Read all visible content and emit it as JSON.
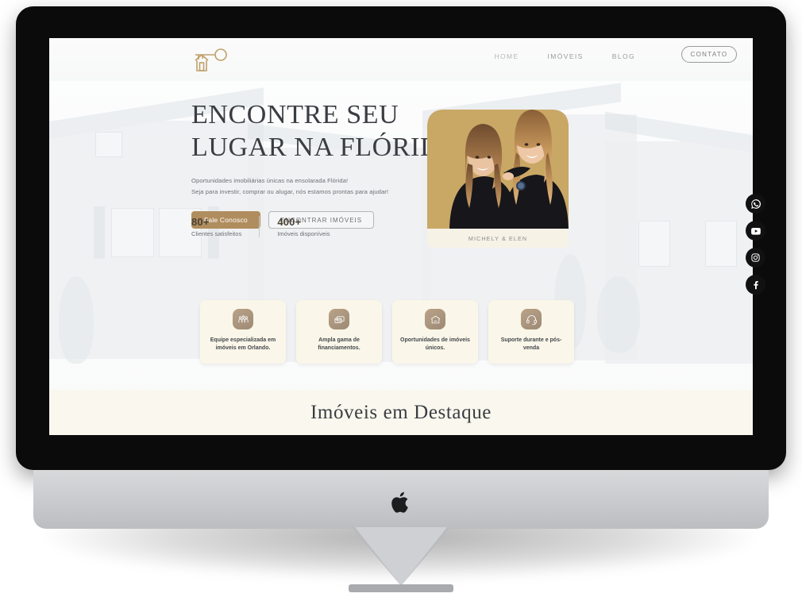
{
  "device": {
    "brand_icon": "apple-logo"
  },
  "site": {
    "logo": "key-house-logo",
    "nav": [
      {
        "label": "HOME",
        "name": "nav-home"
      },
      {
        "label": "IMÓVEIS",
        "name": "nav-imoveis"
      },
      {
        "label": "BLOG",
        "name": "nav-blog"
      }
    ],
    "contact_button": "CONTATO"
  },
  "hero": {
    "title_line1": "ENCONTRE SEU",
    "title_line2": "LUGAR NA FLÓRIDA",
    "sub_line1": "Oportunidades imobiliárias únicas na ensolarada Flórida!",
    "sub_line2": "Seja para investir, comprar ou alugar, nós estamos prontas para ajudar!",
    "btn_primary": "Fale Conosco",
    "btn_secondary": "ENCONTRAR IMÓVEIS",
    "stats": [
      {
        "number": "80+",
        "label": "Clientes satisfeitos"
      },
      {
        "number": "400+",
        "label": "Imóveis disponíveis"
      }
    ],
    "photo_caption": "MICHELY & ELEN"
  },
  "features": [
    {
      "icon": "people-icon",
      "text": "Equipe especializada em imóveis em Orlando."
    },
    {
      "icon": "cards-icon",
      "text": "Ampla gama de financiamentos."
    },
    {
      "icon": "house-icon",
      "text": "Oportunidades de imóveis únicos."
    },
    {
      "icon": "headset-icon",
      "text": "Suporte durante e pós-venda"
    }
  ],
  "section": {
    "title": "Imóveis em Destaque"
  },
  "social": [
    {
      "name": "whatsapp-icon"
    },
    {
      "name": "youtube-icon"
    },
    {
      "name": "instagram-icon"
    },
    {
      "name": "facebook-icon"
    }
  ],
  "colors": {
    "gold": "#b08d5e",
    "cream": "#faf6e9",
    "band": "#faf8ee",
    "photo_gold": "#c9a765",
    "text_dark": "#3a3d42"
  }
}
